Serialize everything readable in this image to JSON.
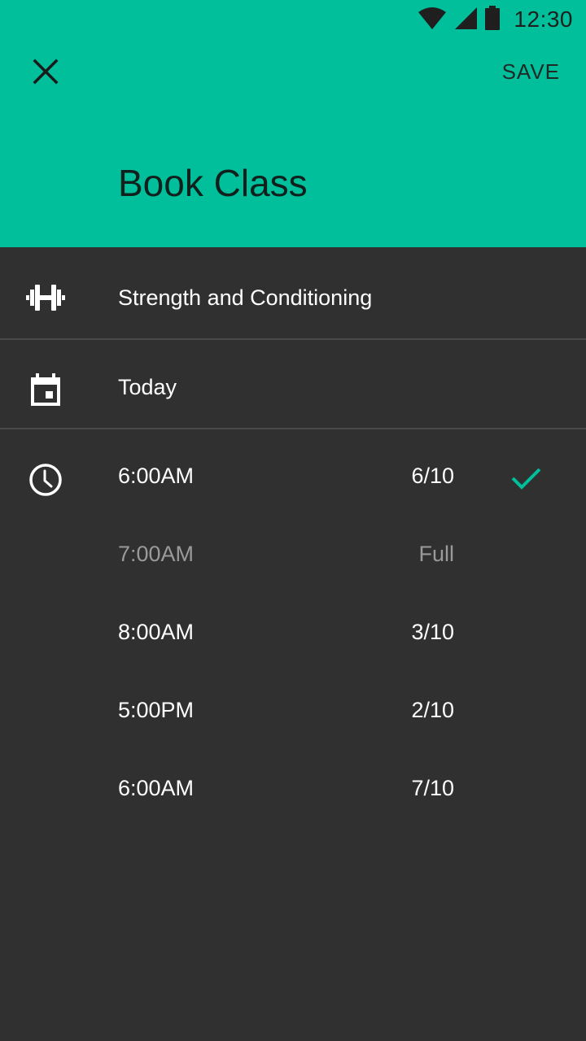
{
  "status_bar": {
    "time": "12:30",
    "icons": [
      "wifi-icon",
      "signal-icon",
      "battery-icon"
    ]
  },
  "toolbar": {
    "close_icon": "close-icon",
    "save_label": "SAVE"
  },
  "header": {
    "title": "Book Class"
  },
  "class_row": {
    "icon": "dumbbell-icon",
    "label": "Strength and Conditioning"
  },
  "date_row": {
    "icon": "calendar-icon",
    "label": "Today"
  },
  "time_row": {
    "icon": "clock-icon"
  },
  "slots": [
    {
      "time": "6:00AM",
      "count": "6/10",
      "selected": true,
      "disabled": false
    },
    {
      "time": "7:00AM",
      "count": "Full",
      "selected": false,
      "disabled": true
    },
    {
      "time": "8:00AM",
      "count": "3/10",
      "selected": false,
      "disabled": false
    },
    {
      "time": "5:00PM",
      "count": "2/10",
      "selected": false,
      "disabled": false
    },
    {
      "time": "6:00AM",
      "count": "7/10",
      "selected": false,
      "disabled": false
    }
  ],
  "colors": {
    "accent": "#00BF9A",
    "background": "#303030",
    "divider": "#4a4a4a",
    "disabled_text": "#9a9a9a"
  }
}
